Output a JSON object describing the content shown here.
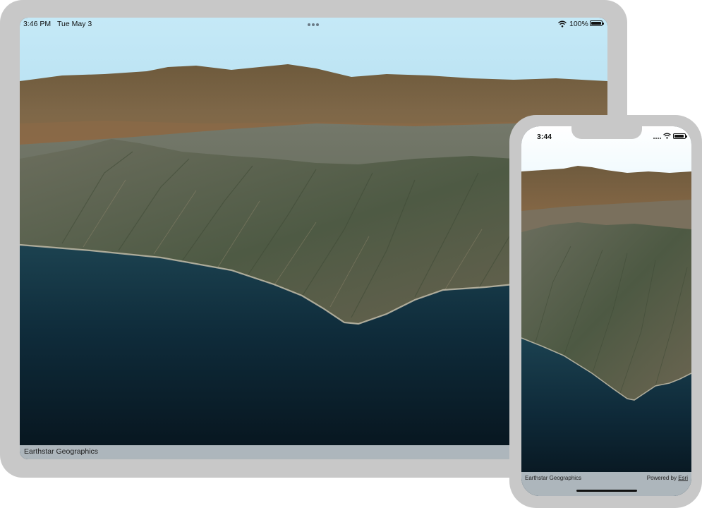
{
  "tablet": {
    "status_bar": {
      "time": "3:46 PM",
      "date": "Tue May 3",
      "battery_percent": "100%",
      "battery_level": 1.0,
      "icons": [
        "multitasking-dots-icon",
        "wifi-icon",
        "battery-icon"
      ]
    },
    "attribution": "Earthstar Geographics"
  },
  "phone": {
    "status_bar": {
      "time": "3:44",
      "icons": [
        "signal-icon",
        "wifi-icon",
        "battery-icon"
      ],
      "battery_level": 0.95
    },
    "attribution_left": "Earthstar Geographics",
    "powered_by": "Powered by",
    "powered_by_link": "Esri"
  },
  "colors": {
    "device_frame": "#c8c8c8",
    "sky_top": "#bfe6f5",
    "sky_bottom": "#8fc6e0",
    "ocean": "#0b2030",
    "attribution_bar": "#d7dfe4"
  }
}
